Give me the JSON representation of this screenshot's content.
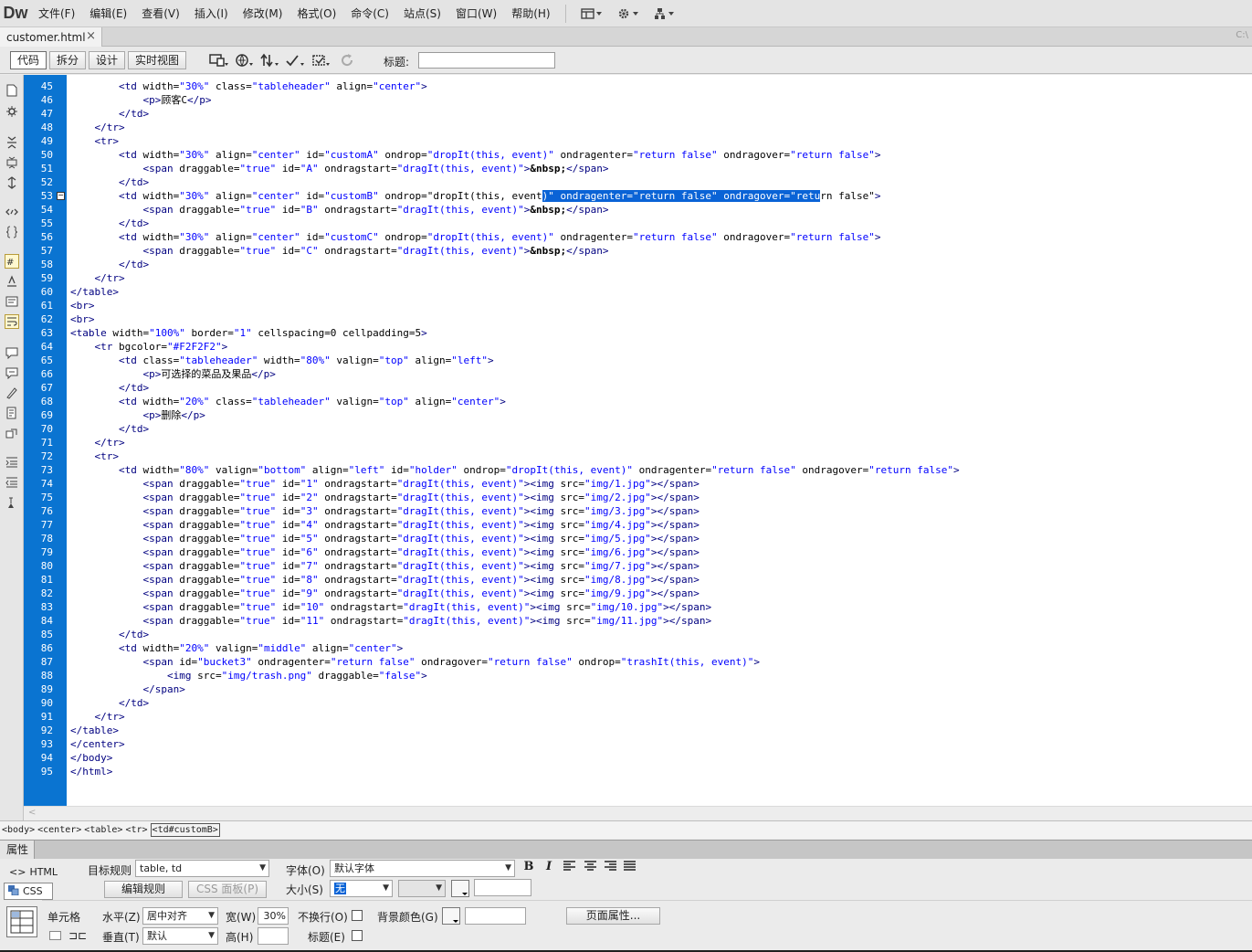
{
  "menubar": {
    "logo": "Dw",
    "items": [
      "文件(F)",
      "编辑(E)",
      "查看(V)",
      "插入(I)",
      "修改(M)",
      "格式(O)",
      "命令(C)",
      "站点(S)",
      "窗口(W)",
      "帮助(H)"
    ],
    "icons": [
      "layout-icon",
      "gear-icon",
      "site-icon"
    ]
  },
  "tabs": {
    "active_file": "customer.html",
    "close_glyph": "×",
    "path_hint": "C:\\"
  },
  "toolbar": {
    "view_buttons": [
      "代码",
      "拆分",
      "设计",
      "实时视图"
    ],
    "active_view": "代码",
    "title_label": "标题:",
    "title_value": ""
  },
  "editor": {
    "line_numbers": [
      "45",
      "46",
      "47",
      "48",
      "49",
      "50",
      "51",
      "52",
      "53",
      "54",
      "55",
      "56",
      "57",
      "58",
      "59",
      "60",
      "61",
      "62",
      "63",
      "64",
      "65",
      "66",
      "67",
      "68",
      "69",
      "70",
      "71",
      "72",
      "73",
      "74",
      "75",
      "76",
      "77",
      "78",
      "79",
      "80",
      "81",
      "82",
      "83",
      "84",
      "85",
      "86",
      "87",
      "88",
      "89",
      "90",
      "91",
      "92",
      "93",
      "94",
      "95"
    ],
    "fold_line": "53",
    "selection_line": "53",
    "code_lines": [
      "        <td width=\"30%\" class=\"tableheader\" align=\"center\">",
      "            <p>顾客C</p>",
      "        </td>",
      "    </tr>",
      "    <tr>",
      "        <td width=\"30%\" align=\"center\" id=\"customA\" ondrop=\"dropIt(this, event)\" ondragenter=\"return false\" ondragover=\"return false\">",
      "            <span draggable=\"true\" id=\"A\" ondragstart=\"dragIt(this, event)\">&nbsp;</span>",
      "        </td>",
      "        <td width=\"30%\" align=\"center\" id=\"customB\" ondrop=\"dropIt(this, event)\" ondragenter=\"return false\" ondragover=\"return false\">",
      "            <span draggable=\"true\" id=\"B\" ondragstart=\"dragIt(this, event)\">&nbsp;</span>",
      "        </td>",
      "        <td width=\"30%\" align=\"center\" id=\"customC\" ondrop=\"dropIt(this, event)\" ondragenter=\"return false\" ondragover=\"return false\">",
      "            <span draggable=\"true\" id=\"C\" ondragstart=\"dragIt(this, event)\">&nbsp;</span>",
      "        </td>",
      "    </tr>",
      "</table>",
      "<br>",
      "<br>",
      "<table width=\"100%\" border=\"1\" cellspacing=0 cellpadding=5>",
      "    <tr bgcolor=\"#F2F2F2\">",
      "        <td class=\"tableheader\" width=\"80%\" valign=\"top\" align=\"left\">",
      "            <p>可选择的菜品及果品</p>",
      "        </td>",
      "        <td width=\"20%\" class=\"tableheader\" valign=\"top\" align=\"center\">",
      "            <p>删除</p>",
      "        </td>",
      "    </tr>",
      "    <tr>",
      "        <td width=\"80%\" valign=\"bottom\" align=\"left\" id=\"holder\" ondrop=\"dropIt(this, event)\" ondragenter=\"return false\" ondragover=\"return false\">",
      "            <span draggable=\"true\" id=\"1\" ondragstart=\"dragIt(this, event)\"><img src=\"img/1.jpg\"></span>",
      "            <span draggable=\"true\" id=\"2\" ondragstart=\"dragIt(this, event)\"><img src=\"img/2.jpg\"></span>",
      "            <span draggable=\"true\" id=\"3\" ondragstart=\"dragIt(this, event)\"><img src=\"img/3.jpg\"></span>",
      "            <span draggable=\"true\" id=\"4\" ondragstart=\"dragIt(this, event)\"><img src=\"img/4.jpg\"></span>",
      "            <span draggable=\"true\" id=\"5\" ondragstart=\"dragIt(this, event)\"><img src=\"img/5.jpg\"></span>",
      "            <span draggable=\"true\" id=\"6\" ondragstart=\"dragIt(this, event)\"><img src=\"img/6.jpg\"></span>",
      "            <span draggable=\"true\" id=\"7\" ondragstart=\"dragIt(this, event)\"><img src=\"img/7.jpg\"></span>",
      "            <span draggable=\"true\" id=\"8\" ondragstart=\"dragIt(this, event)\"><img src=\"img/8.jpg\"></span>",
      "            <span draggable=\"true\" id=\"9\" ondragstart=\"dragIt(this, event)\"><img src=\"img/9.jpg\"></span>",
      "            <span draggable=\"true\" id=\"10\" ondragstart=\"dragIt(this, event)\"><img src=\"img/10.jpg\"></span>",
      "            <span draggable=\"true\" id=\"11\" ondragstart=\"dragIt(this, event)\"><img src=\"img/11.jpg\"></span>",
      "        </td>",
      "        <td width=\"20%\" valign=\"middle\" align=\"center\">",
      "            <span id=\"bucket3\" ondragenter=\"return false\" ondragover=\"return false\" ondrop=\"trashIt(this, event)\">",
      "                <img src=\"img/trash.png\" draggable=\"false\">",
      "            </span>",
      "        </td>",
      "    </tr>",
      "</table>",
      "</center>",
      "</body>",
      "</html>"
    ]
  },
  "tag_selector": [
    "<body>",
    "<center>",
    "<table>",
    "<tr>",
    "<td#customB>"
  ],
  "properties": {
    "panel_title": "属性",
    "html_mode": "HTML",
    "css_mode": "CSS",
    "target_rule_label": "目标规则",
    "target_rule_value": "table, td",
    "edit_rule_button": "编辑规则",
    "css_panel_button": "CSS 面板(P)",
    "font_label": "字体(O)",
    "font_value": "默认字体",
    "size_label": "大小(S)",
    "size_value": "无",
    "cell_label": "单元格",
    "horiz_label": "水平(Z)",
    "horiz_value": "居中对齐",
    "vert_label": "垂直(T)",
    "vert_value": "默认",
    "width_label": "宽(W)",
    "width_value": "30%",
    "height_label": "高(H)",
    "height_value": "",
    "nowrap_label": "不换行(O)",
    "header_label": "标题(E)",
    "bgcolor_label": "背景颜色(G)",
    "page_props_button": "页面属性...",
    "format_buttons": [
      "B",
      "I"
    ]
  },
  "colors": {
    "gutter": "#0A74D1",
    "selection": "#0A63D6",
    "tag": "#000080",
    "attr_value": "#0000FF"
  }
}
